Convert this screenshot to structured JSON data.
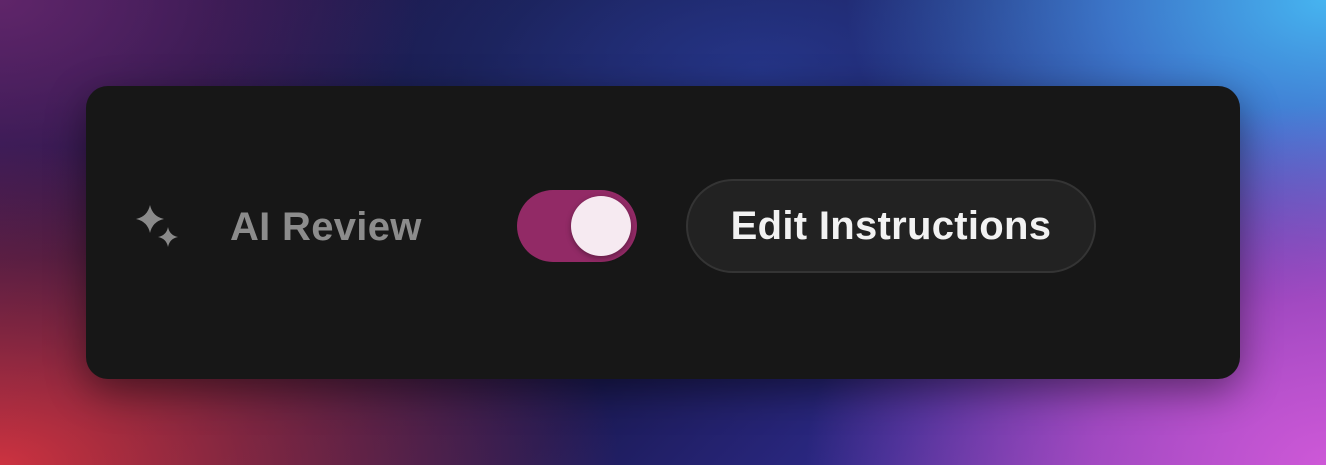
{
  "panel": {
    "icon": "sparkles-icon",
    "label": "AI Review",
    "toggle": {
      "state": "on",
      "accent_color": "#922a66",
      "knob_color": "#f6eaf1"
    },
    "edit_button_label": "Edit Instructions"
  },
  "colors": {
    "card_background": "#171717",
    "label_text": "#8c8c8c",
    "button_background": "#222222",
    "button_text": "#f2f2f2"
  }
}
